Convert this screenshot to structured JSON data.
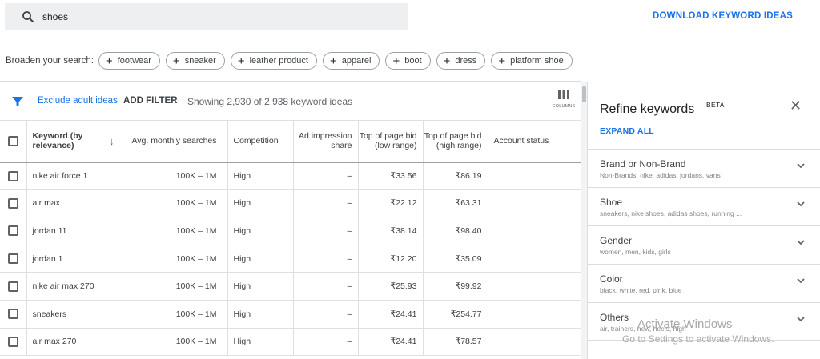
{
  "search": {
    "value": "shoes"
  },
  "download_label": "DOWNLOAD KEYWORD IDEAS",
  "broaden": {
    "label": "Broaden your search:",
    "chips": [
      "footwear",
      "sneaker",
      "leather product",
      "apparel",
      "boot",
      "dress",
      "platform shoe"
    ]
  },
  "toolbar": {
    "exclude_label": "Exclude adult ideas",
    "add_filter_label": "ADD FILTER",
    "showing_text": "Showing 2,930 of 2,938 keyword ideas",
    "columns_label": "COLUMNS"
  },
  "table": {
    "headers": {
      "keyword": "Keyword (by relevance)",
      "avg": "Avg. monthly searches",
      "competition": "Competition",
      "ad_impression": "Ad impression share",
      "bid_low": "Top of page bid (low range)",
      "bid_high": "Top of page bid (high range)",
      "account": "Account status"
    },
    "rows": [
      {
        "keyword": "nike air force 1",
        "avg": "100K – 1M",
        "competition": "High",
        "ad": "–",
        "low": "₹33.56",
        "high": "₹86.19",
        "account": ""
      },
      {
        "keyword": "air max",
        "avg": "100K – 1M",
        "competition": "High",
        "ad": "–",
        "low": "₹22.12",
        "high": "₹63.31",
        "account": ""
      },
      {
        "keyword": "jordan 11",
        "avg": "100K – 1M",
        "competition": "High",
        "ad": "–",
        "low": "₹38.14",
        "high": "₹98.40",
        "account": ""
      },
      {
        "keyword": "jordan 1",
        "avg": "100K – 1M",
        "competition": "High",
        "ad": "–",
        "low": "₹12.20",
        "high": "₹35.09",
        "account": ""
      },
      {
        "keyword": "nike air max 270",
        "avg": "100K – 1M",
        "competition": "High",
        "ad": "–",
        "low": "₹25.93",
        "high": "₹99.92",
        "account": ""
      },
      {
        "keyword": "sneakers",
        "avg": "100K – 1M",
        "competition": "High",
        "ad": "–",
        "low": "₹24.41",
        "high": "₹254.77",
        "account": ""
      },
      {
        "keyword": "air max 270",
        "avg": "100K – 1M",
        "competition": "High",
        "ad": "–",
        "low": "₹24.41",
        "high": "₹78.57",
        "account": ""
      }
    ]
  },
  "refine": {
    "title": "Refine keywords",
    "beta": "BETA",
    "expand_all": "EXPAND ALL",
    "sections": [
      {
        "title": "Brand or Non-Brand",
        "sub": "Non-Brands, nike, adidas, jordans, vans"
      },
      {
        "title": "Shoe",
        "sub": "sneakers, nike shoes, adidas shoes, running ..."
      },
      {
        "title": "Gender",
        "sub": "women, men, kids, girls"
      },
      {
        "title": "Color",
        "sub": "black, white, red, pink, blue"
      },
      {
        "title": "Others",
        "sub": "air, trainers, new, heels, high"
      }
    ]
  },
  "watermark": {
    "line1": "Activate Windows",
    "line2": "Go to Settings to activate Windows."
  },
  "colors": {
    "accent": "#1a73e8",
    "search_bg": "#eeeff1"
  }
}
